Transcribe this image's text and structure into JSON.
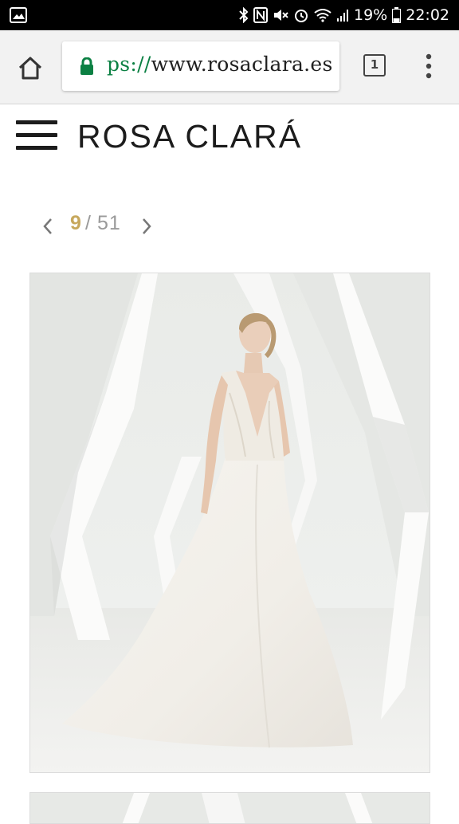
{
  "status_bar": {
    "battery_percent": "19%",
    "time": "22:02",
    "icons": [
      "gallery-notification-icon",
      "bluetooth-icon",
      "nfc-icon",
      "mute-icon",
      "alarm-icon",
      "wifi-icon",
      "signal-icon",
      "battery-icon"
    ]
  },
  "browser": {
    "url_scheme": "ps://",
    "url_host": "www.rosaclara.es",
    "tab_count": "1",
    "secure": true
  },
  "site": {
    "brand": "ROSA CLARÁ"
  },
  "pager": {
    "current": "9",
    "separator": "/",
    "total": "51"
  },
  "colors": {
    "secure_green": "#0b8043",
    "pager_gold": "#c7a85d",
    "pager_gray": "#9a9a9a",
    "brand_text": "#1c1c1c"
  }
}
